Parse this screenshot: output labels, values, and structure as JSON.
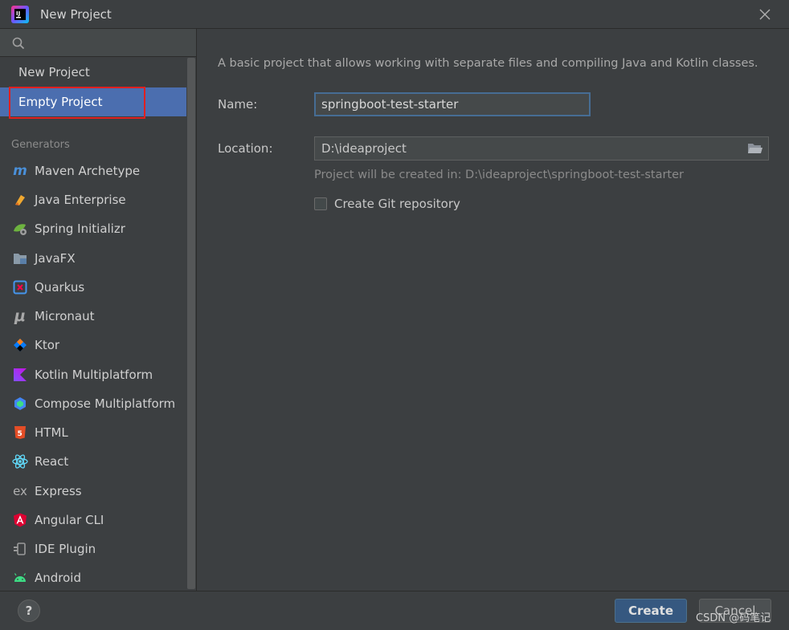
{
  "window": {
    "title": "New Project"
  },
  "search": {
    "value": "",
    "placeholder": ""
  },
  "sidebar": {
    "top_items": [
      {
        "label": "New Project",
        "selected": false
      },
      {
        "label": "Empty Project",
        "selected": true
      }
    ],
    "section_label": "Generators",
    "generators": [
      {
        "label": "Maven Archetype",
        "icon": "maven-icon"
      },
      {
        "label": "Java Enterprise",
        "icon": "java-enterprise-icon"
      },
      {
        "label": "Spring Initializr",
        "icon": "spring-icon"
      },
      {
        "label": "JavaFX",
        "icon": "javafx-icon"
      },
      {
        "label": "Quarkus",
        "icon": "quarkus-icon"
      },
      {
        "label": "Micronaut",
        "icon": "micronaut-icon"
      },
      {
        "label": "Ktor",
        "icon": "ktor-icon"
      },
      {
        "label": "Kotlin Multiplatform",
        "icon": "kotlin-icon"
      },
      {
        "label": "Compose Multiplatform",
        "icon": "compose-icon"
      },
      {
        "label": "HTML",
        "icon": "html5-icon"
      },
      {
        "label": "React",
        "icon": "react-icon"
      },
      {
        "label": "Express",
        "icon": "express-icon"
      },
      {
        "label": "Angular CLI",
        "icon": "angular-icon"
      },
      {
        "label": "IDE Plugin",
        "icon": "plugin-icon"
      },
      {
        "label": "Android",
        "icon": "android-icon"
      }
    ]
  },
  "main": {
    "description": "A basic project that allows working with separate files and compiling Java and Kotlin classes.",
    "name_label": "Name:",
    "name_value": "springboot-test-starter",
    "location_label": "Location:",
    "location_value": "D:\\ideaproject",
    "location_hint": "Project will be created in: D:\\ideaproject\\springboot-test-starter",
    "git_checkbox_label": "Create Git repository",
    "git_checked": false
  },
  "footer": {
    "help_label": "?",
    "create_label": "Create",
    "cancel_label": "Cancel",
    "watermark": "CSDN @码笔记"
  },
  "colors": {
    "background": "#3c3f41",
    "selection": "#4b6eaf",
    "highlight_outline": "#e02020",
    "primary_button": "#365880"
  }
}
